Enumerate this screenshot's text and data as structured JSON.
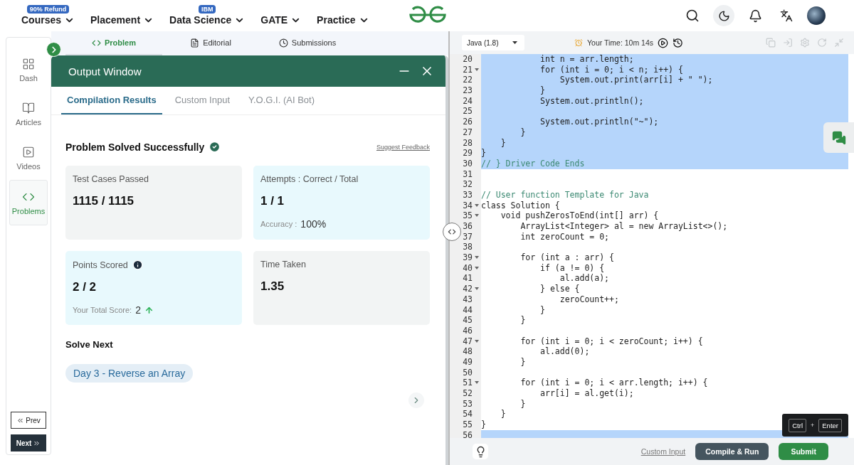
{
  "nav": {
    "items": [
      {
        "label": "Courses",
        "badge": "90% Refund"
      },
      {
        "label": "Placement"
      },
      {
        "label": "Data Science",
        "badge": "IBM"
      },
      {
        "label": "GATE"
      },
      {
        "label": "Practice"
      }
    ]
  },
  "sidebar": {
    "items": [
      {
        "label": "Dash",
        "selected": false
      },
      {
        "label": "Articles",
        "selected": false
      },
      {
        "label": "Videos",
        "selected": false
      },
      {
        "label": "Problems",
        "selected": true
      }
    ],
    "prev": "Prev",
    "next": "Next"
  },
  "problem_tabs": [
    {
      "label": "Problem",
      "selected": true
    },
    {
      "label": "Editorial",
      "selected": false
    },
    {
      "label": "Submissions",
      "selected": false
    }
  ],
  "output_window": {
    "title": "Output Window",
    "tabs": [
      {
        "label": "Compilation Results",
        "selected": true
      },
      {
        "label": "Custom Input",
        "selected": false
      },
      {
        "label": "Y.O.G.I. (AI Bot)",
        "selected": false
      }
    ],
    "status": "Problem Solved Successfully",
    "feedback_link": "Suggest Feedback",
    "cards": [
      {
        "title": "Test Cases Passed",
        "info": false,
        "value": "1115 / 1115",
        "color": "#f2f4f4"
      },
      {
        "title": "Attempts : Correct / Total",
        "info": false,
        "value": "1 / 1",
        "note_label": "Accuracy :",
        "note_value": "100%",
        "color": "#e8f9fd"
      },
      {
        "title": "Points Scored",
        "info": true,
        "value": "2 / 2",
        "note_label": "Your Total Score:",
        "note_value": "2",
        "trend_up": true,
        "color": "#e8f9fd"
      },
      {
        "title": "Time Taken",
        "info": false,
        "value": "1.35",
        "color": "#f2f4f4"
      }
    ],
    "solve_next": {
      "heading": "Solve Next",
      "items": [
        "Day 3 - Reverse an Array"
      ]
    }
  },
  "editor": {
    "language": "Java (1.8)",
    "timer": "Your Time: 10m 14s",
    "lines": [
      {
        "number": "20",
        "selected": true,
        "fold": false,
        "text": "            int n = arr.length;"
      },
      {
        "number": "21",
        "selected": true,
        "fold": true,
        "text": "            for (int i = 0; i < n; i++) {"
      },
      {
        "number": "22",
        "selected": true,
        "fold": false,
        "text": "                System.out.print(arr[i] + \" \");"
      },
      {
        "number": "23",
        "selected": true,
        "fold": false,
        "text": "            }"
      },
      {
        "number": "24",
        "selected": true,
        "fold": false,
        "text": "            System.out.println();"
      },
      {
        "number": "25",
        "selected": true,
        "fold": false
      },
      {
        "number": "26",
        "selected": true,
        "fold": false,
        "text": "            System.out.println(\"~\");"
      },
      {
        "number": "27",
        "selected": true,
        "fold": false,
        "text": "        }"
      },
      {
        "number": "28",
        "selected": true,
        "fold": false,
        "text": "    }"
      },
      {
        "number": "29",
        "selected": true,
        "fold": false,
        "text": "}"
      },
      {
        "number": "30",
        "selected": true,
        "fold": false,
        "kind": "comment",
        "text": "// } Driver Code Ends"
      },
      {
        "number": "31",
        "selected": false,
        "fold": false
      },
      {
        "number": "32",
        "selected": false,
        "fold": false
      },
      {
        "number": "33",
        "selected": false,
        "fold": false,
        "kind": "comment",
        "text": "// User function Template for Java"
      },
      {
        "number": "34",
        "selected": false,
        "fold": true,
        "text": "class Solution {"
      },
      {
        "number": "35",
        "selected": false,
        "fold": true,
        "text": "    void pushZerosToEnd(int[] arr) {"
      },
      {
        "number": "36",
        "selected": false,
        "fold": false,
        "text": "        ArrayList<Integer> al = new ArrayList<>();"
      },
      {
        "number": "37",
        "selected": false,
        "fold": false,
        "text": "        int zeroCount = 0;"
      },
      {
        "number": "38",
        "selected": false,
        "fold": false
      },
      {
        "number": "39",
        "selected": false,
        "fold": true,
        "text": "        for (int a : arr) {"
      },
      {
        "number": "40",
        "selected": false,
        "fold": true,
        "text": "            if (a != 0) {"
      },
      {
        "number": "41",
        "selected": false,
        "fold": false,
        "text": "                al.add(a);"
      },
      {
        "number": "42",
        "selected": false,
        "fold": true,
        "text": "            } else {"
      },
      {
        "number": "43",
        "selected": false,
        "fold": false,
        "text": "                zeroCount++;"
      },
      {
        "number": "44",
        "selected": false,
        "fold": false,
        "text": "            }"
      },
      {
        "number": "45",
        "selected": false,
        "fold": false,
        "text": "        }"
      },
      {
        "number": "46",
        "selected": false,
        "fold": false
      },
      {
        "number": "47",
        "selected": false,
        "fold": true,
        "text": "        for (int i = 0; i < zeroCount; i++) {"
      },
      {
        "number": "48",
        "selected": false,
        "fold": false,
        "text": "            al.add(0);"
      },
      {
        "number": "49",
        "selected": false,
        "fold": false,
        "text": "        }"
      },
      {
        "number": "50",
        "selected": false,
        "fold": false
      },
      {
        "number": "51",
        "selected": false,
        "fold": true,
        "text": "        for (int i = 0; i < arr.length; i++) {"
      },
      {
        "number": "52",
        "selected": false,
        "fold": false,
        "text": "            arr[i] = al.get(i);"
      },
      {
        "number": "53",
        "selected": false,
        "fold": false,
        "text": "        }"
      },
      {
        "number": "54",
        "selected": false,
        "fold": false,
        "text": "    }"
      },
      {
        "number": "55",
        "selected": false,
        "fold": false,
        "text": "}"
      },
      {
        "number": "56",
        "selected": true,
        "fold": false
      }
    ],
    "custom_input": "Custom Input",
    "compile_button": "Compile & Run",
    "submit_button": "Submit",
    "shortcut": {
      "keys": [
        "Ctrl",
        "Enter"
      ],
      "joiner": "+"
    }
  }
}
